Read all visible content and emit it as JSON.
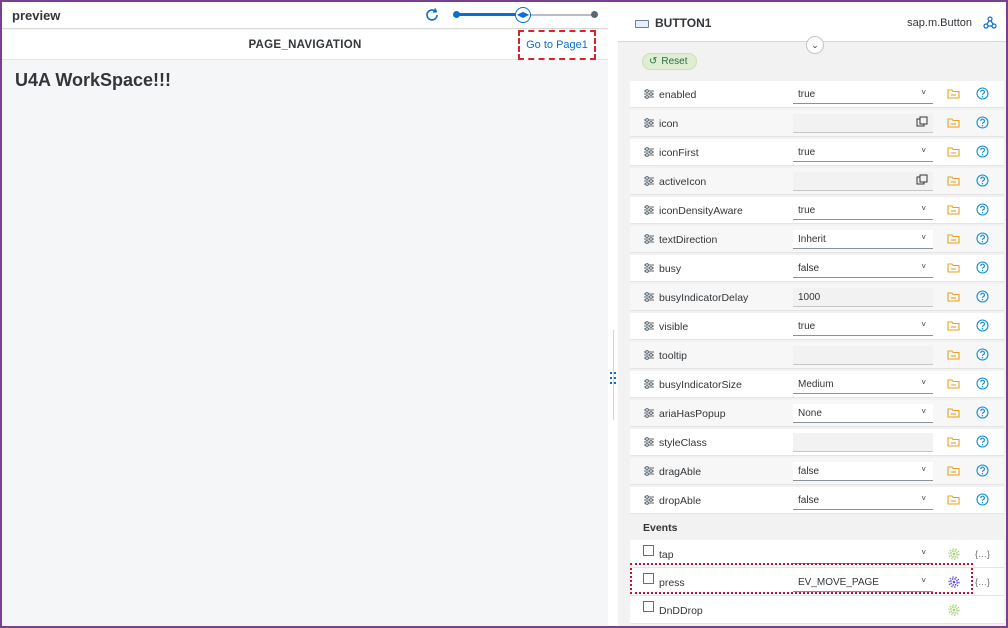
{
  "preview": {
    "title": "preview",
    "page_title": "PAGE_NAVIGATION",
    "goto_button": "Go to Page1",
    "heading": "U4A WorkSpace!!!"
  },
  "panel": {
    "object_name": "BUTTON1",
    "object_class": "sap.m.Button",
    "reset_label": "Reset",
    "events_title": "Events"
  },
  "properties": [
    {
      "name": "enabled",
      "value": "true",
      "kind": "select"
    },
    {
      "name": "icon",
      "value": "",
      "kind": "popup"
    },
    {
      "name": "iconFirst",
      "value": "true",
      "kind": "select"
    },
    {
      "name": "activeIcon",
      "value": "",
      "kind": "popup"
    },
    {
      "name": "iconDensityAware",
      "value": "true",
      "kind": "select"
    },
    {
      "name": "textDirection",
      "value": "Inherit",
      "kind": "select"
    },
    {
      "name": "busy",
      "value": "false",
      "kind": "select"
    },
    {
      "name": "busyIndicatorDelay",
      "value": "1000",
      "kind": "input"
    },
    {
      "name": "visible",
      "value": "true",
      "kind": "select"
    },
    {
      "name": "tooltip",
      "value": "",
      "kind": "input"
    },
    {
      "name": "busyIndicatorSize",
      "value": "Medium",
      "kind": "select"
    },
    {
      "name": "ariaHasPopup",
      "value": "None",
      "kind": "select"
    },
    {
      "name": "styleClass",
      "value": "",
      "kind": "input"
    },
    {
      "name": "dragAble",
      "value": "false",
      "kind": "select"
    },
    {
      "name": "dropAble",
      "value": "false",
      "kind": "select"
    }
  ],
  "events": [
    {
      "name": "tap",
      "value": "",
      "bound": false
    },
    {
      "name": "press",
      "value": "EV_MOVE_PAGE",
      "bound": true
    },
    {
      "name": "DnDDrop",
      "value": "",
      "bound": false
    }
  ],
  "colors": {
    "accent": "#0a6ed1",
    "frame": "#7a3f8f",
    "highlight": "#d9232e",
    "bind_icon": "#e9a21f",
    "help_icon": "#0a8fd8",
    "gear_unbound": "#9fcf6a",
    "gear_bound": "#5b4fd6"
  },
  "icons": {
    "refresh": "refresh-icon",
    "property": "property-settings-icon",
    "bind": "folder-bind-icon",
    "help": "help-icon",
    "popup": "value-help-icon",
    "event_gear": "gear-icon",
    "event_code": "code-brackets-icon",
    "network": "network-icon"
  }
}
